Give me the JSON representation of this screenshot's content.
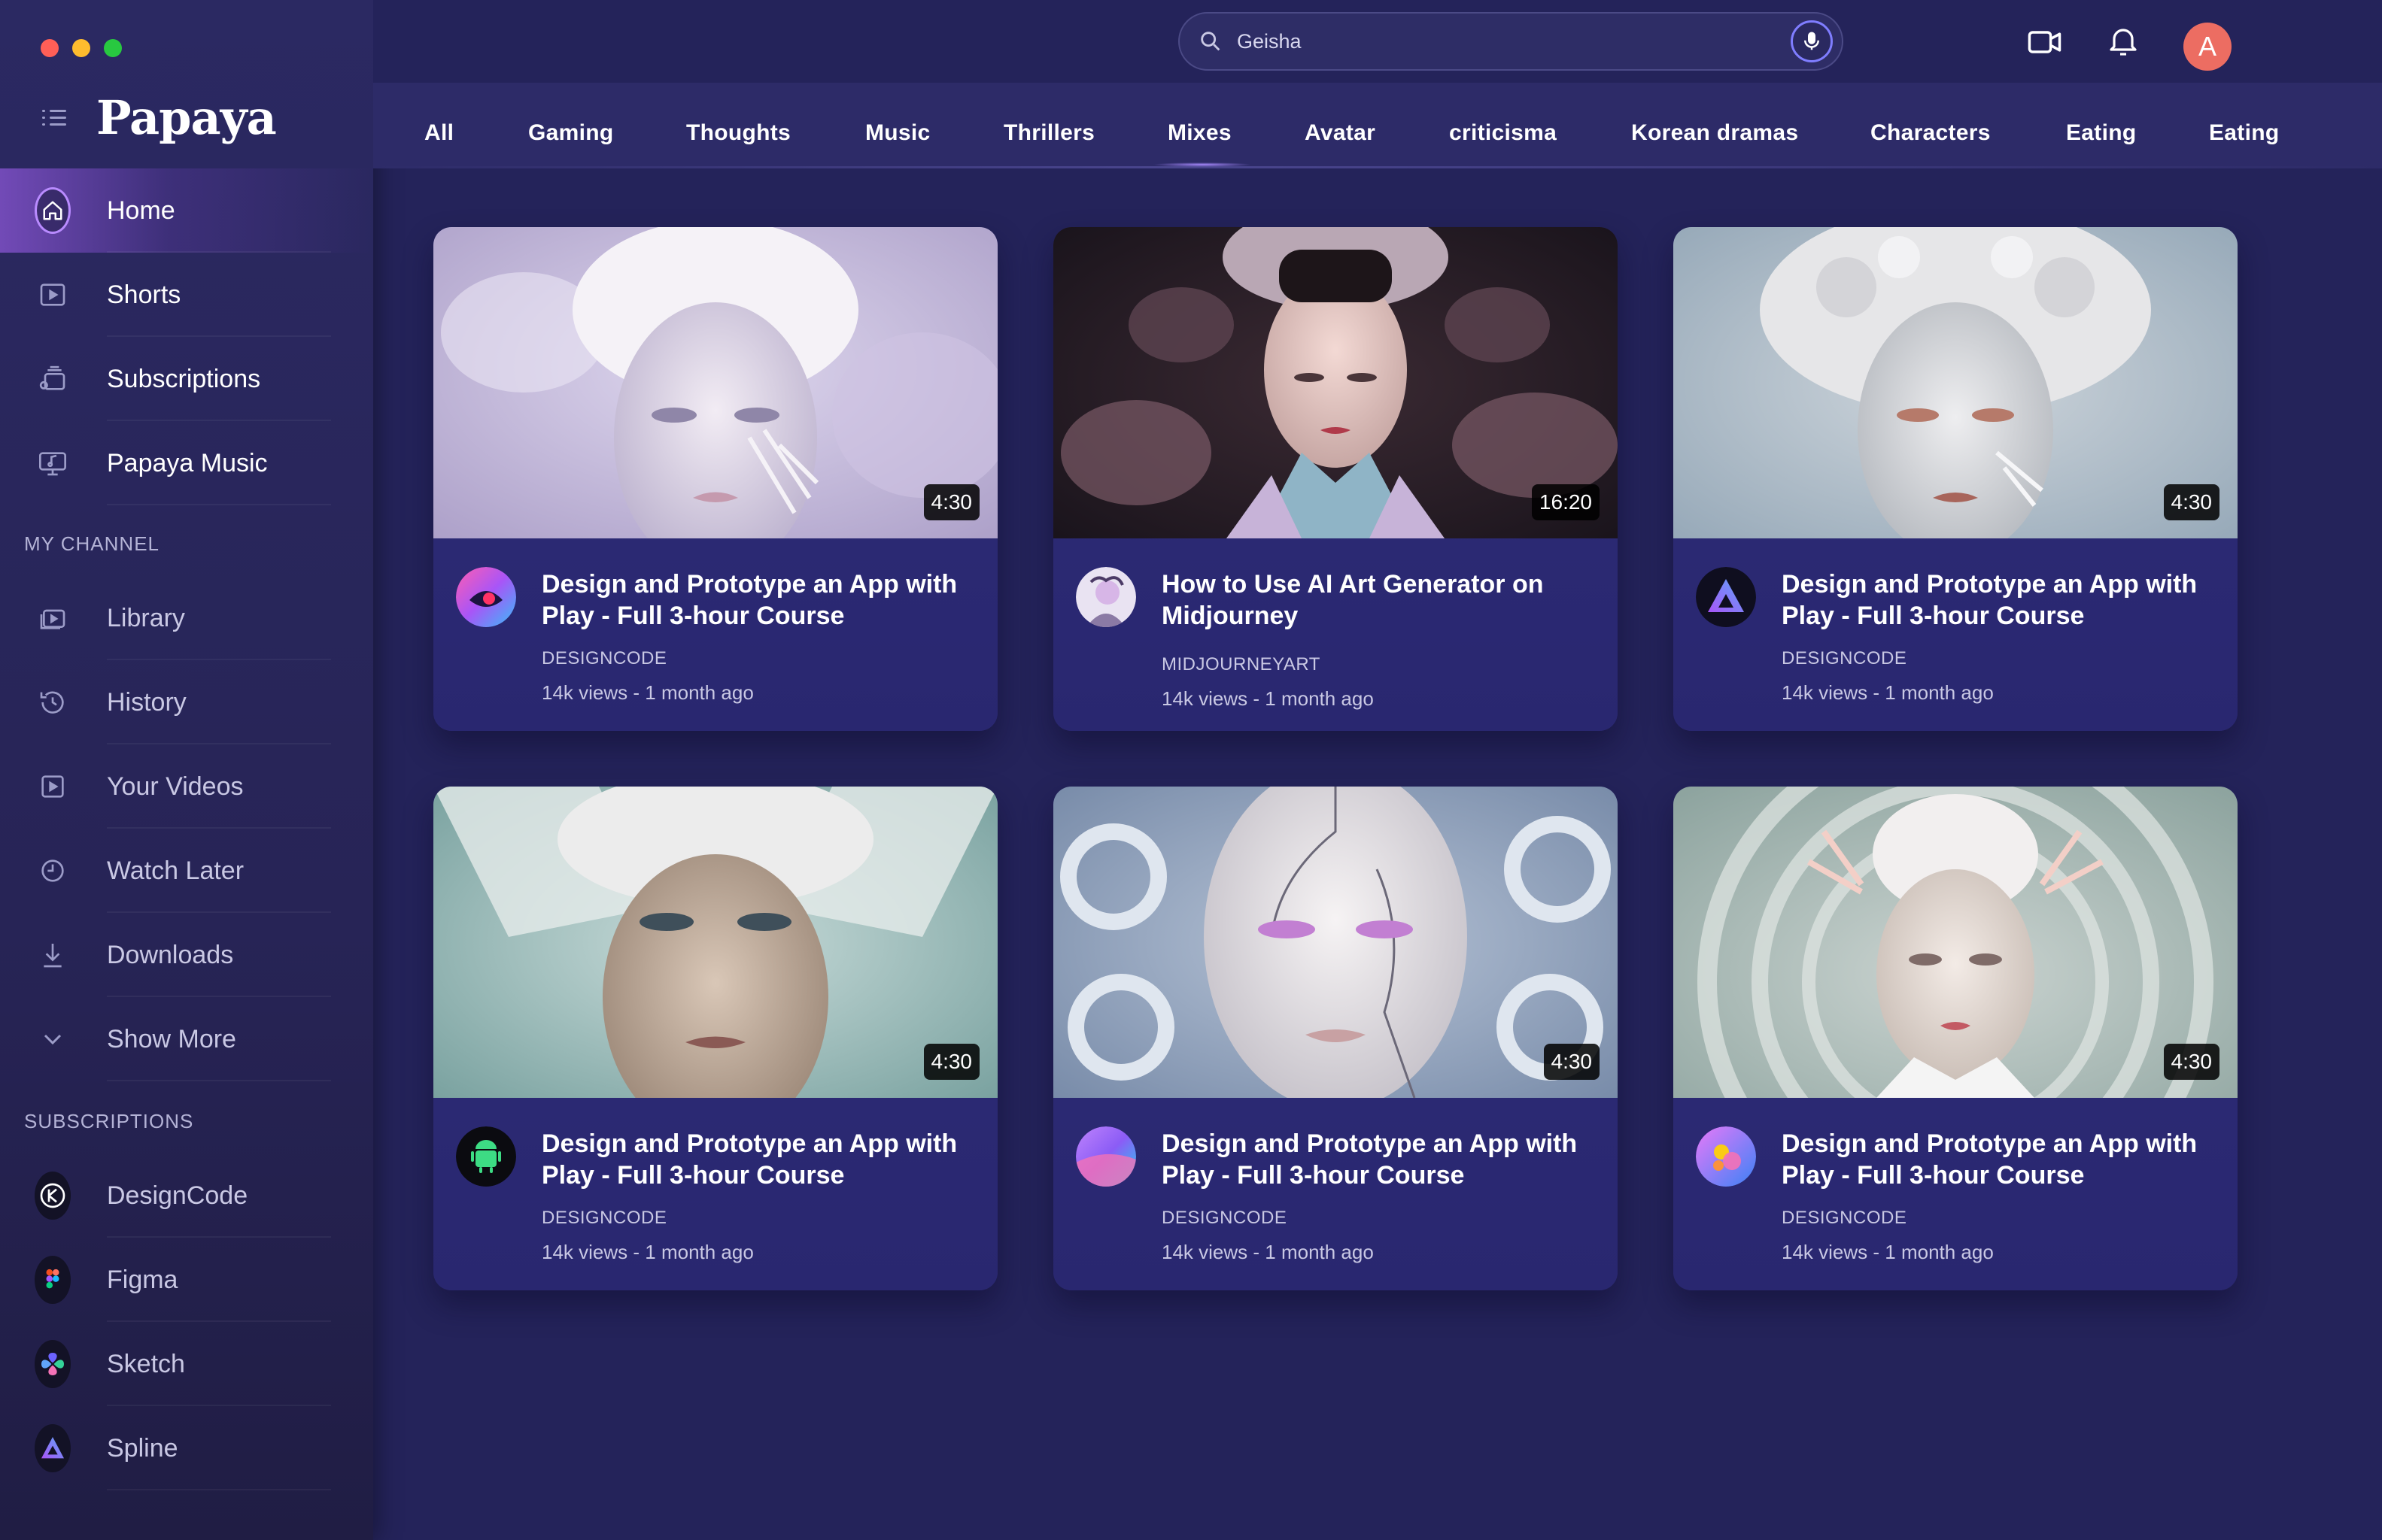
{
  "window": {
    "traffic_lights": [
      "#ff5f57",
      "#febc2e",
      "#28c840"
    ]
  },
  "app": {
    "name": "Papaya"
  },
  "sidebar": {
    "nav": [
      {
        "label": "Home",
        "icon": "home-icon",
        "active": true
      },
      {
        "label": "Shorts",
        "icon": "play-square-icon"
      },
      {
        "label": "Subscriptions",
        "icon": "subscriptions-icon"
      },
      {
        "label": "Papaya Music",
        "icon": "music-screen-icon"
      }
    ],
    "my_channel_title": "MY CHANNEL",
    "my_channel": [
      {
        "label": "Library",
        "icon": "library-icon"
      },
      {
        "label": "History",
        "icon": "history-icon"
      },
      {
        "label": "Your Videos",
        "icon": "your-videos-icon"
      },
      {
        "label": "Watch Later",
        "icon": "clock-icon"
      },
      {
        "label": "Downloads",
        "icon": "download-icon"
      },
      {
        "label": "Show More",
        "icon": "chevron-down-icon"
      }
    ],
    "subscriptions_title": "SUBSCRIPTIONS",
    "subscriptions": [
      {
        "label": "DesignCode",
        "icon": "designcode-logo-icon"
      },
      {
        "label": "Figma",
        "icon": "figma-logo-icon"
      },
      {
        "label": "Sketch",
        "icon": "sketch-logo-icon"
      },
      {
        "label": "Spline",
        "icon": "spline-logo-icon"
      }
    ]
  },
  "search": {
    "value": "Geisha"
  },
  "header": {
    "avatar_initial": "A"
  },
  "categories": [
    "All",
    "Gaming",
    "Thoughts",
    "Music",
    "Thrillers",
    "Mixes",
    "Avatar",
    "criticisma",
    "Korean dramas",
    "Characters",
    "Eating",
    "Eating"
  ],
  "active_category": "Mixes",
  "colors": {
    "accent": "#a98bff",
    "background": "#24235a",
    "avatar": "#ec6d62"
  },
  "videos": [
    {
      "title": "Design and Prototype an App with Play - Full 3-hour Course",
      "channel": "DESIGNCODE",
      "meta": "14k views - 1 month ago",
      "duration": "4:30"
    },
    {
      "title": "How to Use AI Art Generator on Midjourney",
      "channel": "MIDJOURNEYART",
      "meta": "14k views - 1 month ago",
      "duration": "16:20"
    },
    {
      "title": "Design and Prototype an App with Play - Full 3-hour Course",
      "channel": "DESIGNCODE",
      "meta": "14k views - 1 month ago",
      "duration": "4:30"
    },
    {
      "title": "Design and Prototype an App with Play - Full 3-hour Course",
      "channel": "DESIGNCODE",
      "meta": "14k views - 1 month ago",
      "duration": "4:30"
    },
    {
      "title": "Design and Prototype an App with Play - Full 3-hour Course",
      "channel": "DESIGNCODE",
      "meta": "14k views - 1 month ago",
      "duration": "4:30"
    },
    {
      "title": "Design and Prototype an App with Play - Full 3-hour Course",
      "channel": "DESIGNCODE",
      "meta": "14k views - 1 month ago",
      "duration": "4:30"
    }
  ]
}
